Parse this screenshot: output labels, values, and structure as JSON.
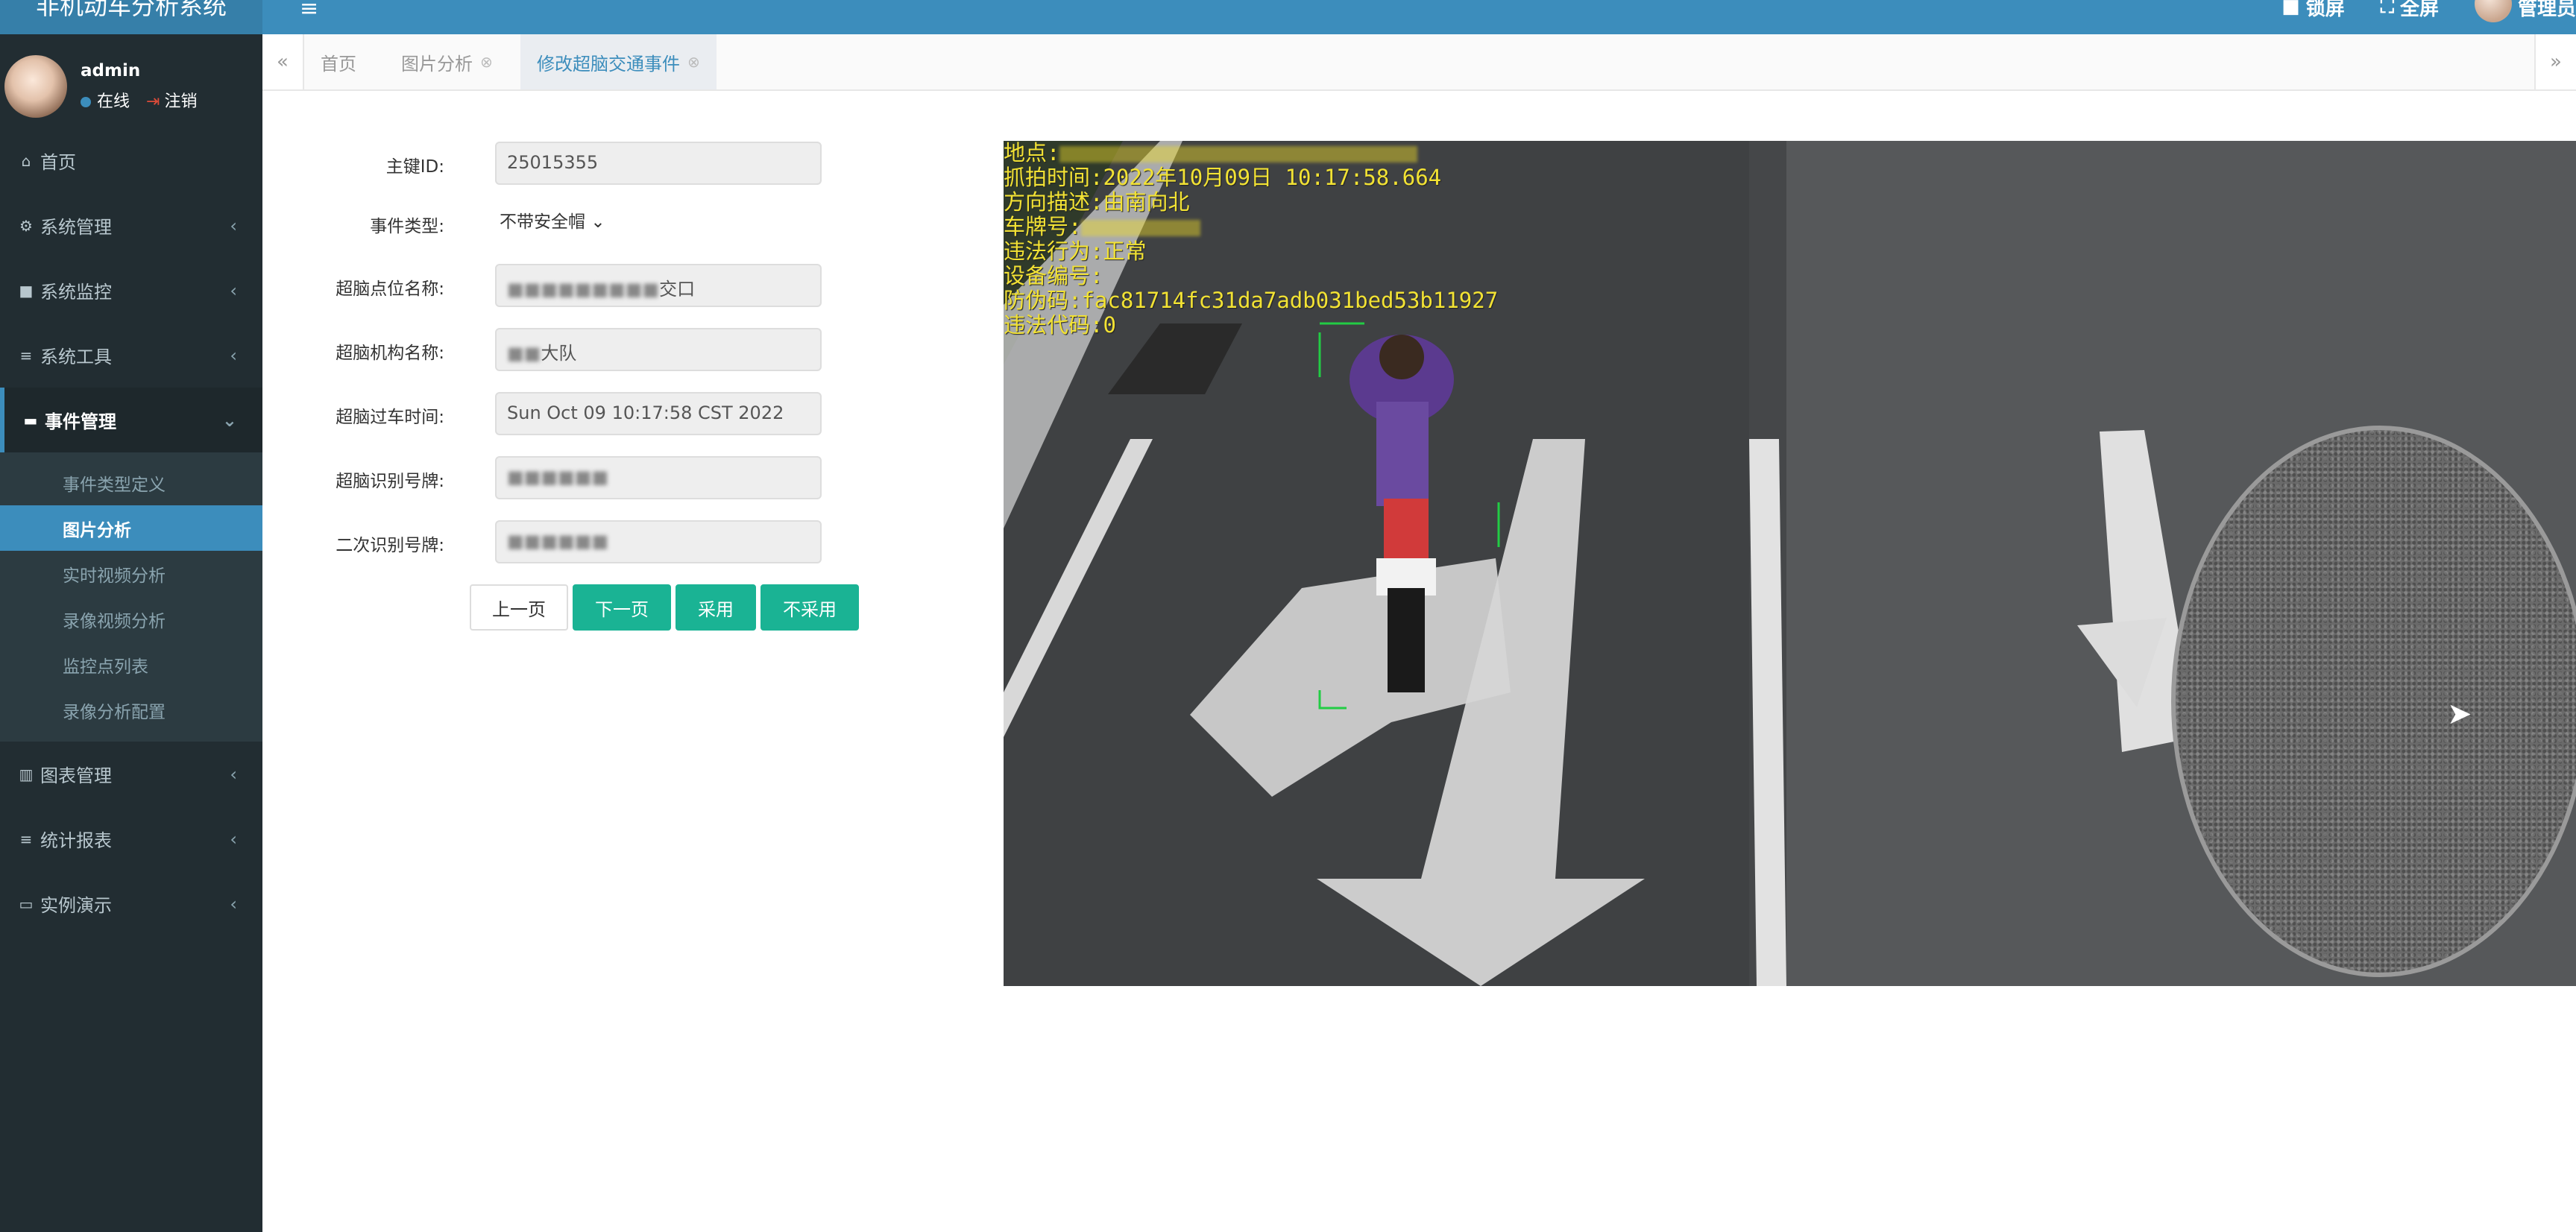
{
  "header": {
    "app_title": "非机动车分析系统",
    "right_items": [
      "锁屏",
      "全屏",
      "管理员"
    ]
  },
  "user": {
    "name": "admin",
    "status_online": "在线",
    "logout": "注销"
  },
  "sidebar": {
    "items": [
      {
        "label": "首页",
        "icon": "home-icon"
      },
      {
        "label": "系统管理",
        "icon": "gear-icon"
      },
      {
        "label": "系统监控",
        "icon": "video-icon"
      },
      {
        "label": "系统工具",
        "icon": "bars-icon"
      },
      {
        "label": "事件管理",
        "icon": "list-icon",
        "expanded": true
      }
    ],
    "submenu": [
      "事件类型定义",
      "图片分析",
      "实时视频分析",
      "录像视频分析",
      "监控点列表",
      "录像分析配置"
    ],
    "current_sub": "图片分析",
    "items_after": [
      {
        "label": "图表管理",
        "icon": "chart-icon"
      },
      {
        "label": "统计报表",
        "icon": "bars-icon"
      },
      {
        "label": "实例演示",
        "icon": "monitor-icon"
      }
    ]
  },
  "tabs": [
    {
      "label": "首页",
      "closable": false
    },
    {
      "label": "图片分析",
      "closable": true
    },
    {
      "label": "修改超脑交通事件",
      "closable": true,
      "active": true
    }
  ],
  "form": {
    "id_label": "主键ID:",
    "id_value": "25015355",
    "event_type_label": "事件类型:",
    "event_type_value": "不带安全帽",
    "point_label": "超脑点位名称:",
    "point_value_visible": "交口",
    "org_label": "超脑机构名称:",
    "org_value_visible": "大队",
    "time_label": "超脑过车时间:",
    "time_value": "Sun Oct 09 10:17:58 CST 2022",
    "plate_label": "超脑识别号牌:",
    "second_plate_label": "二次识别号牌:"
  },
  "buttons": {
    "prev": "上一页",
    "next": "下一页",
    "adopt": "采用",
    "reject": "不采用"
  },
  "photo_overlay": {
    "location": "地点:",
    "capture_time": "抓拍时间:2022年10月09日 10:17:58.664",
    "direction": "方向描述:由南向北",
    "plate": "车牌号:",
    "violation": "违法行为:正常",
    "device": "设备编号:",
    "anti_fake": "防伪码:fac81714fc31da7adb031bed53b11927",
    "violation_code": "违法代码:0"
  },
  "colors": {
    "header": "#3c8dbc",
    "sidebar": "#222d32",
    "primary_button": "#1ab394",
    "overlay_text": "#f2e234"
  }
}
